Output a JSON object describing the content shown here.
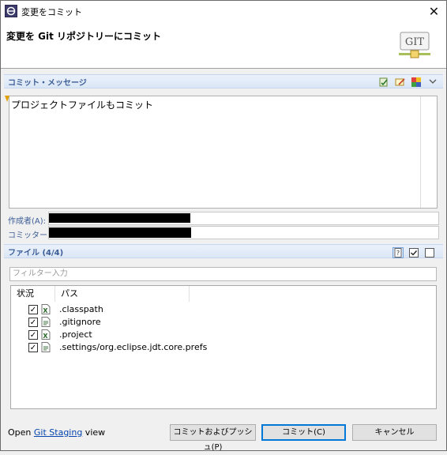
{
  "window": {
    "title": "変更をコミット",
    "close_glyph": "✕"
  },
  "header": {
    "title": "変更を Git リポジトリーにコミット",
    "logo_text": "GIT"
  },
  "commit_message_section": {
    "label": "コミット・メッセージ",
    "message": "プロジェクトファイルもコミット"
  },
  "author": {
    "label": "作成者(A):"
  },
  "committer": {
    "label": "コミッター:"
  },
  "files_section": {
    "label": "ファイル (4/4)",
    "filter_placeholder": "フィルター入力",
    "columns": [
      "状況",
      "パス"
    ],
    "files": [
      {
        "name": ".classpath",
        "checked": true,
        "icon": "xml-file-icon"
      },
      {
        "name": ".gitignore",
        "checked": true,
        "icon": "text-file-icon"
      },
      {
        "name": ".project",
        "checked": true,
        "icon": "xml-file-icon"
      },
      {
        "name": ".settings/org.eclipse.jdt.core.prefs",
        "checked": true,
        "icon": "text-file-icon"
      }
    ]
  },
  "footer": {
    "open_prefix": "Open ",
    "link_text": "Git Staging",
    "open_suffix": " view",
    "commit_push_label": "コミットおよびプッシュ(P)",
    "commit_label": "コミット(C)",
    "cancel_label": "キャンセル"
  },
  "colors": {
    "section_label": "#3c5d96",
    "link": "#0645ad",
    "primary_border": "#0078d7"
  }
}
